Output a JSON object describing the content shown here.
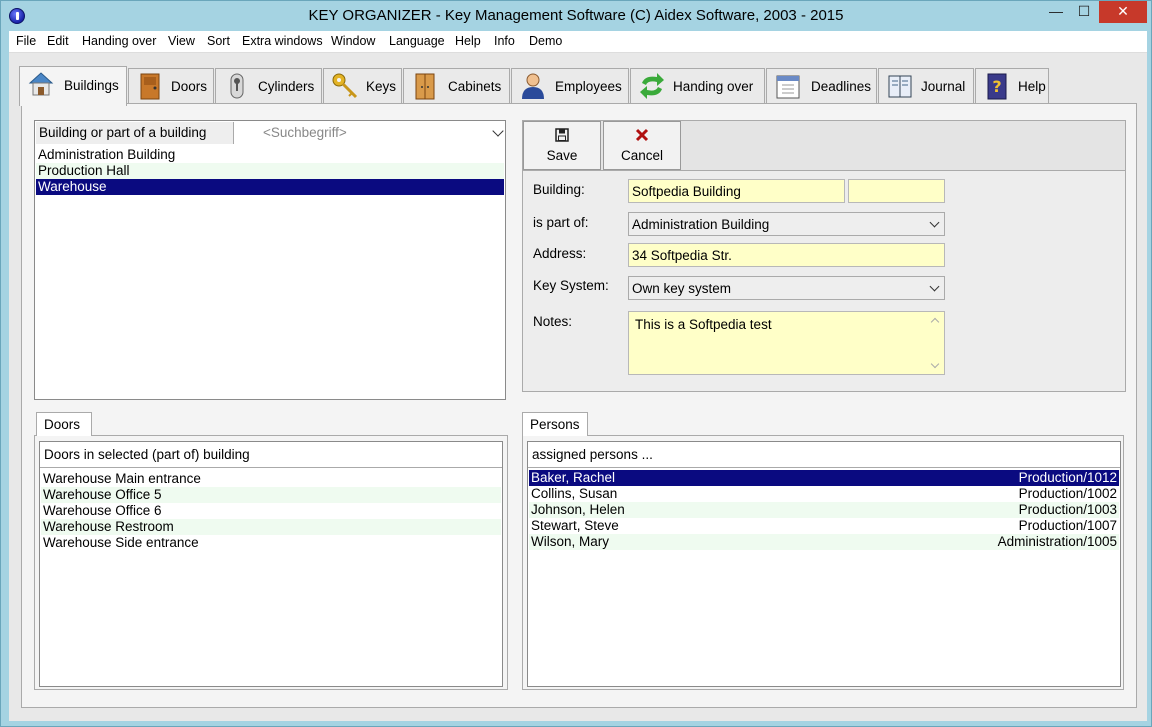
{
  "window": {
    "title": "KEY ORGANIZER  -  Key Management Software     (C) Aidex Software, 2003 - 2015",
    "minimize_label": "—",
    "maximize_label": "☐",
    "close_label": "✕"
  },
  "menu": [
    "File",
    "Edit",
    "Handing over",
    "View",
    "Sort",
    "Extra windows",
    "Window",
    "Language",
    "Help",
    "Info",
    "Demo"
  ],
  "tabs": [
    {
      "label": "Buildings",
      "icon": "house-icon",
      "active": true
    },
    {
      "label": "Doors",
      "icon": "door-icon"
    },
    {
      "label": "Cylinders",
      "icon": "cylinder-icon"
    },
    {
      "label": "Keys",
      "icon": "key-icon"
    },
    {
      "label": "Cabinets",
      "icon": "cabinet-icon"
    },
    {
      "label": "Employees",
      "icon": "employee-icon"
    },
    {
      "label": "Handing over",
      "icon": "exchange-arrows-icon"
    },
    {
      "label": "Deadlines",
      "icon": "calendar-icon"
    },
    {
      "label": "Journal",
      "icon": "journal-icon"
    },
    {
      "label": "Help",
      "icon": "help-book-icon"
    }
  ],
  "buildings": {
    "header": "Building or part of a building",
    "search_placeholder": "<Suchbegriff>",
    "items": [
      "Administration Building",
      "Production Hall",
      "Warehouse"
    ],
    "selected_index": 2
  },
  "toolbar": {
    "save_label": "Save",
    "cancel_label": "Cancel"
  },
  "form": {
    "building_label": "Building:",
    "building_value": "Softpedia Building",
    "building_value2": "",
    "part_of_label": "is part of:",
    "part_of_value": "Administration Building",
    "address_label": "Address:",
    "address_value": "34 Softpedia Str.",
    "key_system_label": "Key System:",
    "key_system_value": "Own key system",
    "notes_label": "Notes:",
    "notes_value": "This is a Softpedia test"
  },
  "doors": {
    "tab_label": "Doors",
    "header": "Doors in selected (part of) building",
    "items": [
      "Warehouse Main entrance",
      "Warehouse Office 5",
      "Warehouse Office 6",
      "Warehouse Restroom",
      "Warehouse Side entrance"
    ]
  },
  "persons": {
    "tab_label": "Persons",
    "header": "assigned persons ...",
    "items": [
      {
        "name": "Baker, Rachel",
        "dept": "Production/1012"
      },
      {
        "name": "Collins, Susan",
        "dept": "Production/1002"
      },
      {
        "name": "Johnson, Helen",
        "dept": "Production/1003"
      },
      {
        "name": "Stewart, Steve",
        "dept": "Production/1007"
      },
      {
        "name": "Wilson, Mary",
        "dept": "Administration/1005"
      }
    ],
    "selected_index": 0
  },
  "colors": {
    "selection": "#0a0a80",
    "field_background": "#ffffc8",
    "alt_row": "#effbf0",
    "frame": "#a5d3e2"
  }
}
